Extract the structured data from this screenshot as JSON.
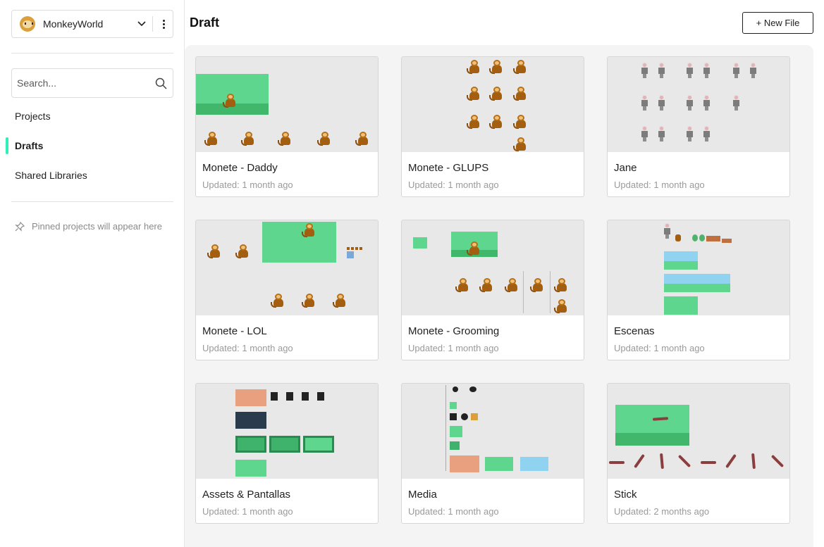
{
  "sidebar": {
    "team_name": "MonkeyWorld",
    "search_placeholder": "Search...",
    "nav": [
      {
        "label": "Projects",
        "active": false
      },
      {
        "label": "Drafts",
        "active": true
      },
      {
        "label": "Shared Libraries",
        "active": false
      }
    ],
    "pinned_message": "Pinned projects will appear here"
  },
  "main": {
    "title": "Draft",
    "new_file_label": "+ New File"
  },
  "files": [
    {
      "name": "Monete - Daddy",
      "updated": "Updated: 1 month ago"
    },
    {
      "name": "Monete - GLUPS",
      "updated": "Updated: 1 month ago"
    },
    {
      "name": "Jane",
      "updated": "Updated: 1 month ago"
    },
    {
      "name": "Monete - LOL",
      "updated": "Updated: 1 month ago"
    },
    {
      "name": "Monete - Grooming",
      "updated": "Updated: 1 month ago"
    },
    {
      "name": "Escenas",
      "updated": "Updated: 1 month ago"
    },
    {
      "name": "Assets & Pantallas",
      "updated": "Updated: 1 month ago"
    },
    {
      "name": "Media",
      "updated": "Updated: 1 month ago"
    },
    {
      "name": "Stick",
      "updated": "Updated: 2 months ago"
    }
  ],
  "colors": {
    "active_indicator": "#31efb8",
    "thumbnail_green": "#5fd68e",
    "monkey_brown": "#a35e10"
  }
}
